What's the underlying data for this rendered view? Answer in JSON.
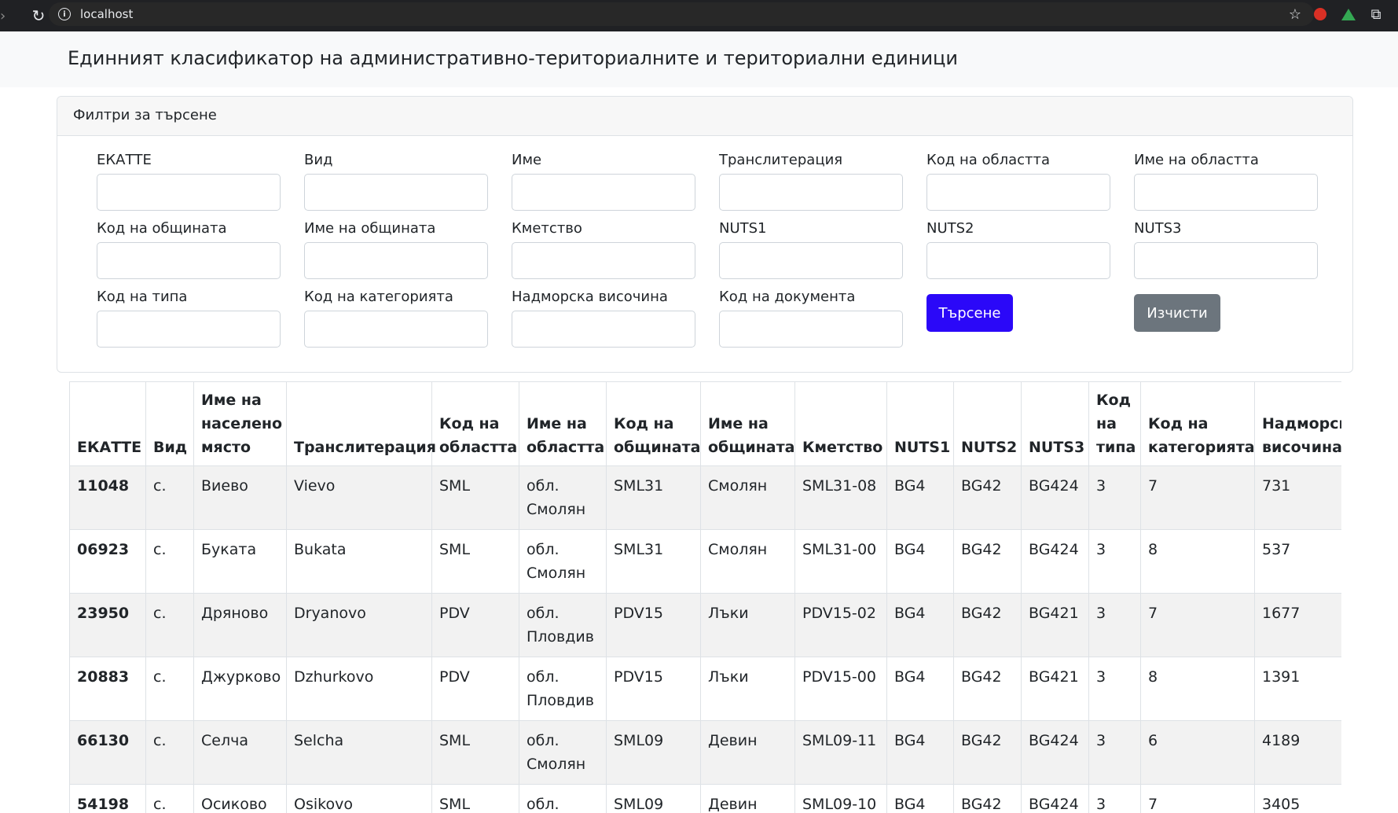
{
  "browser": {
    "url": "localhost"
  },
  "header": {
    "title": "Единният класификатор на административно-териториалните и териториални единици"
  },
  "filters": {
    "title": "Филтри за търсене",
    "fields": [
      {
        "label": "ЕКАТТЕ",
        "value": ""
      },
      {
        "label": "Вид",
        "value": ""
      },
      {
        "label": "Име",
        "value": ""
      },
      {
        "label": "Транслитерация",
        "value": ""
      },
      {
        "label": "Код на областта",
        "value": ""
      },
      {
        "label": "Име на областта",
        "value": ""
      },
      {
        "label": "Код на общината",
        "value": ""
      },
      {
        "label": "Име на общината",
        "value": ""
      },
      {
        "label": "Кметство",
        "value": ""
      },
      {
        "label": "NUTS1",
        "value": ""
      },
      {
        "label": "NUTS2",
        "value": ""
      },
      {
        "label": "NUTS3",
        "value": ""
      },
      {
        "label": "Код на типа",
        "value": ""
      },
      {
        "label": "Код на категорията",
        "value": ""
      },
      {
        "label": "Надморска височина",
        "value": ""
      },
      {
        "label": "Код на документа",
        "value": ""
      }
    ],
    "search_label": "Търсене",
    "clear_label": "Изчисти"
  },
  "table": {
    "columns": [
      "ЕКАТТЕ",
      "Вид",
      "Име на населено място",
      "Транслитерация",
      "Код на областта",
      "Име на областта",
      "Код на общината",
      "Име на общината",
      "Кметство",
      "NUTS1",
      "NUTS2",
      "NUTS3",
      "Код на типа",
      "Код на категорията",
      "Надморска височина"
    ],
    "rows": [
      [
        "11048",
        "с.",
        "Виево",
        "Vievo",
        "SML",
        "обл. Смолян",
        "SML31",
        "Смолян",
        "SML31-08",
        "BG4",
        "BG42",
        "BG424",
        "3",
        "7",
        "731"
      ],
      [
        "06923",
        "с.",
        "Буката",
        "Bukata",
        "SML",
        "обл. Смолян",
        "SML31",
        "Смолян",
        "SML31-00",
        "BG4",
        "BG42",
        "BG424",
        "3",
        "8",
        "537"
      ],
      [
        "23950",
        "с.",
        "Дряново",
        "Dryanovo",
        "PDV",
        "обл. Пловдив",
        "PDV15",
        "Лъки",
        "PDV15-02",
        "BG4",
        "BG42",
        "BG421",
        "3",
        "7",
        "1677"
      ],
      [
        "20883",
        "с.",
        "Джурково",
        "Dzhurkovo",
        "PDV",
        "обл. Пловдив",
        "PDV15",
        "Лъки",
        "PDV15-00",
        "BG4",
        "BG42",
        "BG421",
        "3",
        "8",
        "1391"
      ],
      [
        "66130",
        "с.",
        "Селча",
        "Selcha",
        "SML",
        "обл. Смолян",
        "SML09",
        "Девин",
        "SML09-11",
        "BG4",
        "BG42",
        "BG424",
        "3",
        "6",
        "4189"
      ],
      [
        "54198",
        "с.",
        "Осиково",
        "Osikovo",
        "SML",
        "обл.",
        "SML09",
        "Девин",
        "SML09-10",
        "BG4",
        "BG42",
        "BG424",
        "3",
        "7",
        "3405"
      ]
    ]
  }
}
